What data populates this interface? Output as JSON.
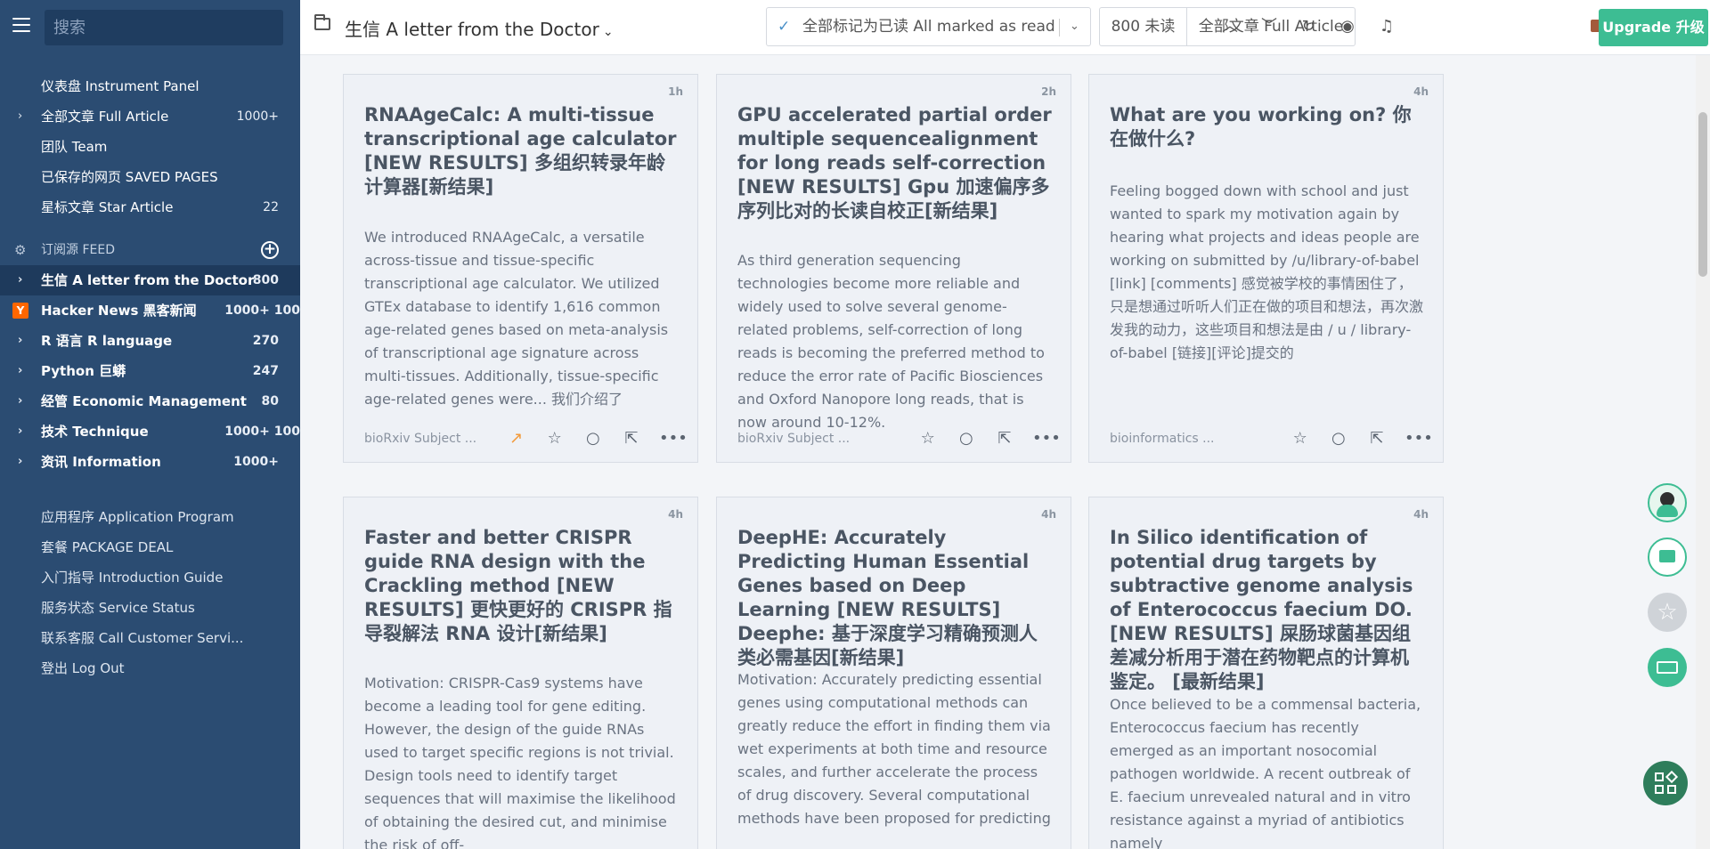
{
  "sidebar": {
    "search_placeholder": "搜索",
    "top_items": [
      {
        "label": "仪表盘 Instrument Panel",
        "count": ""
      },
      {
        "label": "全部文章 Full Article",
        "count": "1000+"
      },
      {
        "label": "团队 Team",
        "count": ""
      },
      {
        "label": "已保存的网页 SAVED PAGES",
        "count": ""
      },
      {
        "label": "星标文章 Star Article",
        "count": "22"
      }
    ],
    "feed_header": "订阅源 FEED",
    "feeds": [
      {
        "label": "生信 A letter from the Doctor",
        "count": "800"
      },
      {
        "label": "Hacker News 黑客新闻",
        "count": "1000+ 100"
      },
      {
        "label": "R 语言 R language",
        "count": "270"
      },
      {
        "label": "Python 巨蟒",
        "count": "247"
      },
      {
        "label": "经管 Economic Management",
        "count": "80"
      },
      {
        "label": "技术 Technique",
        "count": "1000+ 100"
      },
      {
        "label": "资讯 Information",
        "count": "1000+"
      }
    ],
    "bottom_items": [
      {
        "label": "应用程序 Application Program"
      },
      {
        "label": "套餐 PACKAGE DEAL"
      },
      {
        "label": "入门指导 Introduction Guide"
      },
      {
        "label": "服务状态 Service Status"
      },
      {
        "label": "联系客服 Call Customer Servi..."
      },
      {
        "label": "登出 Log Out"
      }
    ]
  },
  "header": {
    "title": "生信 A letter from the Doctor",
    "mark_read": "全部标记为已读 All marked as read",
    "unread": "800 未读",
    "full_article": "全部文章 Full Article",
    "upgrade": "Upgrade 升级"
  },
  "cards": [
    {
      "time": "1h",
      "title": "RNAAgeCalc: A multi-tissue transcriptional age calculator [NEW RESULTS] 多组织转录年龄计算器[新结果]",
      "summary": "We introduced RNAAgeCalc, a versatile across-tissue and tissue-specific transcriptional age calculator. We utilized GTEx database to identify 1,616 common age-related genes based on meta-analysis of transcriptional age signature across multi-tissues. Additionally, tissue-specific age-related genes were... 我们介绍了",
      "source": "bioRxiv Subject ...",
      "trending": true
    },
    {
      "time": "2h",
      "title": "GPU accelerated partial order multiple sequencealignment for long reads self-correction [NEW RESULTS] Gpu 加速偏序多序列比对的长读自校正[新结果]",
      "summary": "As third generation sequencing technologies become more reliable and widely used to solve several genome-related problems, self-correction of long reads is becoming the preferred method to reduce the error rate of Pacific Biosciences and Oxford Nanopore long reads, that is now around 10-12%.",
      "source": "bioRxiv Subject ...",
      "trending": false
    },
    {
      "time": "4h",
      "title": "What are you working on? 你在做什么?",
      "summary": "Feeling bogged down with school and just wanted to spark my motivation again by hearing what projects and ideas people are working on submitted by /u/library-of-babel [link] [comments] 感觉被学校的事情困住了，只是想通过听听人们正在做的项目和想法，再次激发我的动力，这些项目和想法是由 / u / library-of-babel [链接][评论]提交的",
      "source": "bioinformatics ...",
      "trending": false
    },
    {
      "time": "4h",
      "title": "Faster and better CRISPR guide RNA design with the Crackling method [NEW RESULTS] 更快更好的 CRISPR 指导裂解法 RNA 设计[新结果]",
      "summary": "Motivation: CRISPR-Cas9 systems have become a leading tool for gene editing. However, the design of the guide RNAs used to target specific regions is not trivial. Design tools need to identify target sequences that will maximise the likelihood of obtaining the desired cut, and minimise the risk of off-",
      "source": "",
      "trending": false
    },
    {
      "time": "4h",
      "title": "DeepHE: Accurately Predicting Human Essential Genes based on Deep Learning [NEW RESULTS] Deephe: 基于深度学习精确预测人类必需基因[新结果]",
      "summary": "Motivation: Accurately predicting essential genes using computational methods can greatly reduce the effort in finding them via wet experiments at both time and resource scales, and further accelerate the process of drug discovery. Several computational methods have been proposed for predicting",
      "source": "",
      "trending": false
    },
    {
      "time": "4h",
      "title": "In Silico identification of potential drug targets by subtractive genome analysis of Enterococcus faecium DO. [NEW RESULTS] 屎肠球菌基因组差减分析用于潜在药物靶点的计算机鉴定。 [最新结果]",
      "summary": "Once believed to be a commensal bacteria, Enterococcus faecium has recently emerged as an important nosocomial pathogen worldwide. A recent outbreak of E. faecium unrevealed natural and in vitro resistance against a myriad of antibiotics namely",
      "source": "",
      "trending": false
    }
  ]
}
